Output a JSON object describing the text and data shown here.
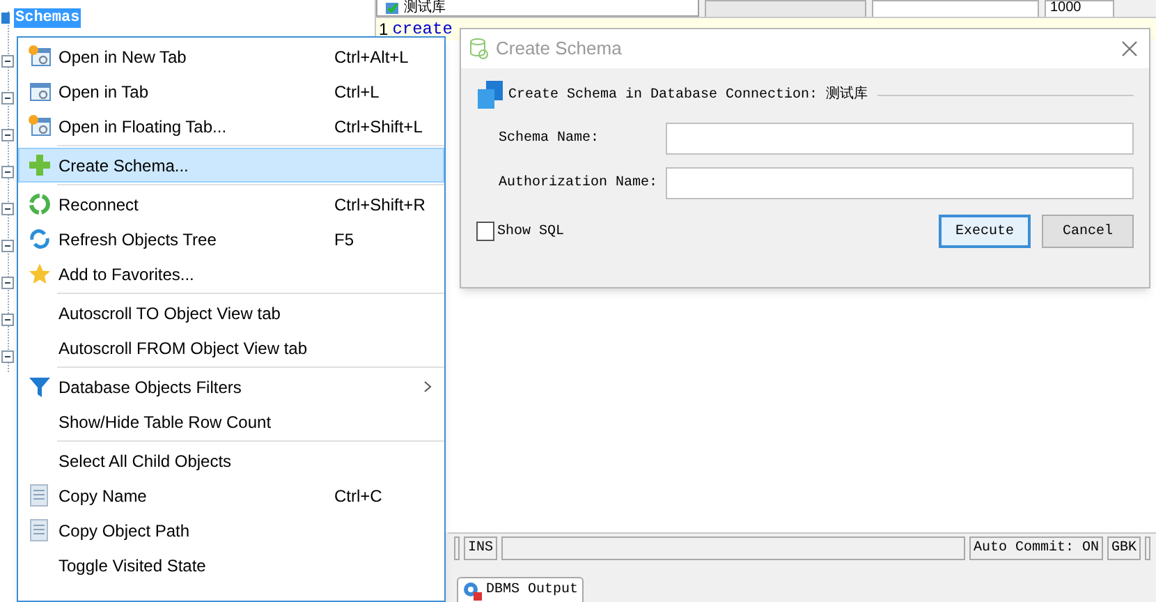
{
  "toolbar": {
    "connection": "测试库",
    "limit": "1000"
  },
  "editor": {
    "line_number": "1",
    "code": "create"
  },
  "tree": {
    "items": [
      {
        "label": "Schemas",
        "selected": true
      }
    ]
  },
  "context_menu": {
    "items": [
      {
        "kind": "item",
        "label": "Open in New Tab",
        "shortcut": "Ctrl+Alt+L",
        "selected": false,
        "submenu": false
      },
      {
        "kind": "item",
        "label": "Open in Tab",
        "shortcut": "Ctrl+L",
        "selected": false,
        "submenu": false
      },
      {
        "kind": "item",
        "label": "Open in Floating Tab...",
        "shortcut": "Ctrl+Shift+L",
        "selected": false,
        "submenu": false
      },
      {
        "kind": "separator"
      },
      {
        "kind": "item",
        "label": "Create Schema...",
        "selected": true,
        "submenu": false
      },
      {
        "kind": "separator"
      },
      {
        "kind": "item",
        "label": "Reconnect",
        "shortcut": "Ctrl+Shift+R",
        "selected": false,
        "submenu": false
      },
      {
        "kind": "item",
        "label": "Refresh Objects Tree",
        "shortcut": "F5",
        "selected": false,
        "submenu": false
      },
      {
        "kind": "item",
        "label": "Add to Favorites...",
        "selected": false,
        "submenu": false
      },
      {
        "kind": "separator"
      },
      {
        "kind": "item",
        "label": "Autoscroll TO Object View tab",
        "selected": false,
        "submenu": false
      },
      {
        "kind": "item",
        "label": "Autoscroll FROM Object View tab",
        "selected": false,
        "submenu": false
      },
      {
        "kind": "separator"
      },
      {
        "kind": "item",
        "label": "Database Objects Filters",
        "selected": false,
        "submenu": true
      },
      {
        "kind": "item",
        "label": "Show/Hide Table Row Count",
        "selected": false,
        "submenu": false
      },
      {
        "kind": "separator"
      },
      {
        "kind": "item",
        "label": "Select All Child Objects",
        "selected": false,
        "submenu": false
      },
      {
        "kind": "item",
        "label": "Copy Name",
        "shortcut": "Ctrl+C",
        "selected": false,
        "submenu": false
      },
      {
        "kind": "item",
        "label": "Copy Object Path",
        "selected": false,
        "submenu": false
      },
      {
        "kind": "item",
        "label": "Toggle Visited State",
        "selected": false,
        "submenu": false
      }
    ]
  },
  "dialog": {
    "title": "Create Schema",
    "heading": "Create Schema in Database Connection: 测试库",
    "fields": [
      {
        "label": "Schema Name:"
      },
      {
        "label": "Authorization Name:"
      }
    ],
    "show_sql": {
      "label": "Show SQL",
      "checked": false
    },
    "buttons": [
      {
        "label": "Execute",
        "focused": true
      },
      {
        "label": "Cancel",
        "focused": false
      }
    ]
  },
  "status_bar": {
    "mode": "INS",
    "auto_commit": "Auto Commit: ON",
    "encoding": "GBK"
  },
  "bottom_tabs": [
    {
      "label": "DBMS Output"
    }
  ]
}
